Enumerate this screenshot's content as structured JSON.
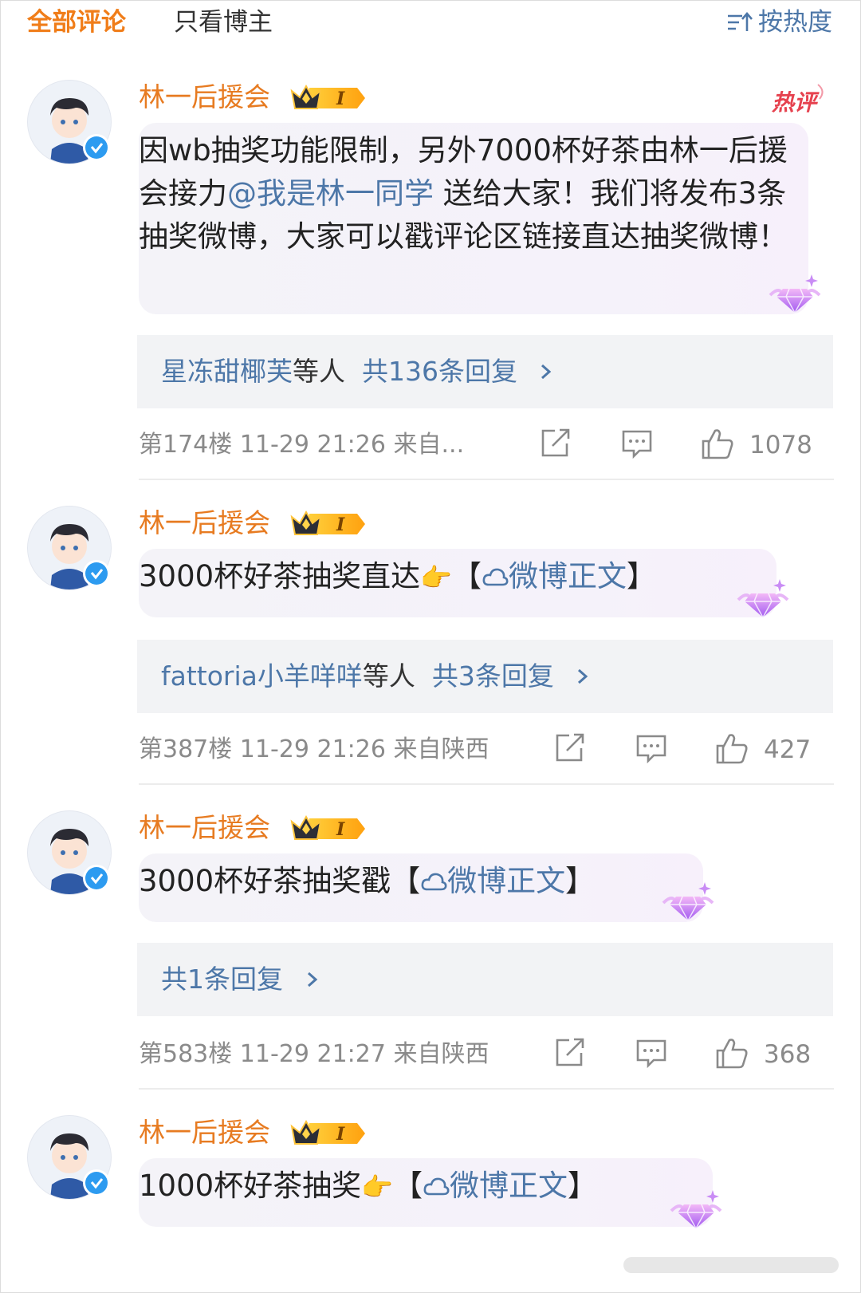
{
  "header": {
    "tabs": [
      {
        "label": "全部评论",
        "active": true
      },
      {
        "label": "只看博主",
        "active": false
      }
    ],
    "sort_label": "按热度"
  },
  "colors": {
    "accent": "#f07d19",
    "link": "#4d77a8",
    "username": "#e77b21",
    "meta": "#8a8a8a"
  },
  "comments": [
    {
      "username": "林一后援会",
      "badge": "crown-level-icon",
      "level": "I",
      "hot_tag": "热评",
      "content_parts": [
        "因wb抽奖功能限制，另外7000杯好茶由林一",
        "后援会接力",
        "@我是林一同学",
        " 送给大家！我们将发布3条抽奖微博，大家可以戳评论区链接直达抽奖微博！"
      ],
      "replies": {
        "users": "星冻甜椰芙",
        "suffix": "等人",
        "count_text": "共136条回复"
      },
      "meta": "第174楼 11-29 21:26 来自...",
      "likes": "1078"
    },
    {
      "username": "林一后援会",
      "badge": "crown-level-icon",
      "level": "I",
      "content_text": "3000杯好茶抽奖直达",
      "bracket_open": "【",
      "link_text": "微博正文",
      "bracket_close": "】",
      "replies": {
        "users": "fattoria小羊咩咩",
        "suffix": "等人",
        "count_text": "共3条回复"
      },
      "meta": "第387楼 11-29 21:26 来自陕西",
      "likes": "427"
    },
    {
      "username": "林一后援会",
      "badge": "crown-level-icon",
      "level": "I",
      "content_text": "3000杯好茶抽奖戳",
      "bracket_open": "【",
      "link_text": "微博正文",
      "bracket_close": "】",
      "replies": {
        "users": "",
        "suffix": "",
        "count_text": "共1条回复"
      },
      "meta": "第583楼 11-29 21:27 来自陕西",
      "likes": "368"
    },
    {
      "username": "林一后援会",
      "badge": "crown-level-icon",
      "level": "I",
      "content_text": "1000杯好茶抽奖",
      "bracket_open": "【",
      "link_text": "微博正文",
      "bracket_close": "】"
    }
  ]
}
